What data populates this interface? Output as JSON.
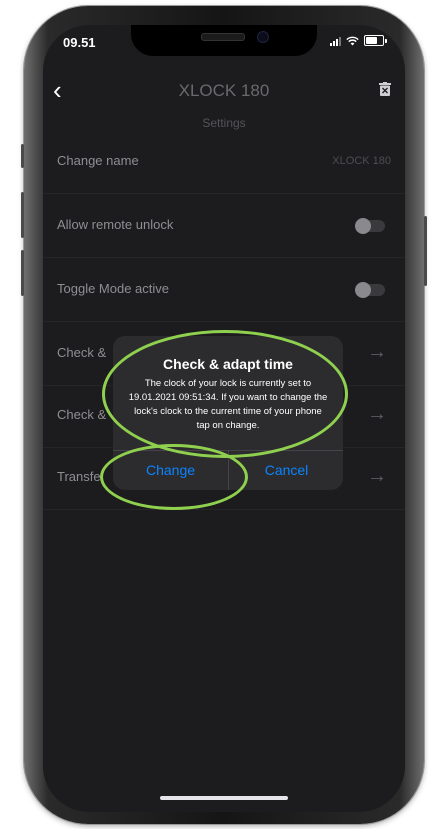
{
  "status_bar": {
    "time": "09.51"
  },
  "header": {
    "title": "XLOCK 180",
    "subtitle": "Settings"
  },
  "rows": [
    {
      "label": "Change name",
      "value": "XLOCK 180"
    },
    {
      "label": "Allow remote unlock"
    },
    {
      "label": "Toggle Mode active"
    },
    {
      "label": "Check &"
    },
    {
      "label": "Check &"
    },
    {
      "label": "Transfe"
    }
  ],
  "dialog": {
    "title": "Check & adapt time",
    "message": "The clock of your lock is currently set to 19.01.2021 09:51:34. If you want to change the lock's clock to the current time of your phone tap on change.",
    "change_label": "Change",
    "cancel_label": "Cancel"
  },
  "colors": {
    "accent": "#0a84ff",
    "annotation": "#8fd14f",
    "background": "#1c1c1e"
  }
}
